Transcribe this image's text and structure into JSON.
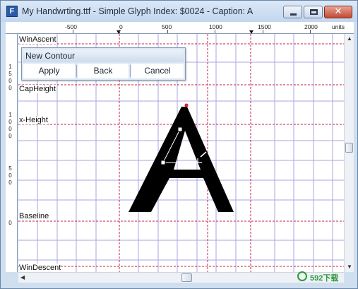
{
  "window": {
    "title": "My Handwrting.ttf - Simple Glyph Index: $0024 - Caption: A",
    "app_icon_glyph": "F"
  },
  "ruler": {
    "h_labels": [
      "-500",
      "0",
      "500",
      "1000",
      "1500",
      "2000"
    ],
    "units_label": "units",
    "v_labels": [
      "1",
      "5",
      "0",
      "0",
      "1",
      "0",
      "0",
      "0",
      "5",
      "0",
      "0",
      "0"
    ]
  },
  "metrics": {
    "win_ascent": "WinAscent",
    "cap_height": "CapHeight",
    "x_height": "x-Height",
    "baseline": "Baseline",
    "win_descent": "WinDescent"
  },
  "dialog": {
    "title": "New Contour",
    "apply": "Apply",
    "back": "Back",
    "cancel": "Cancel"
  },
  "watermark": "592下载",
  "colors": {
    "grid": "#a9a6e2",
    "metric_line": "#c0204a",
    "glyph": "#000000",
    "point_red": "#e02020"
  }
}
